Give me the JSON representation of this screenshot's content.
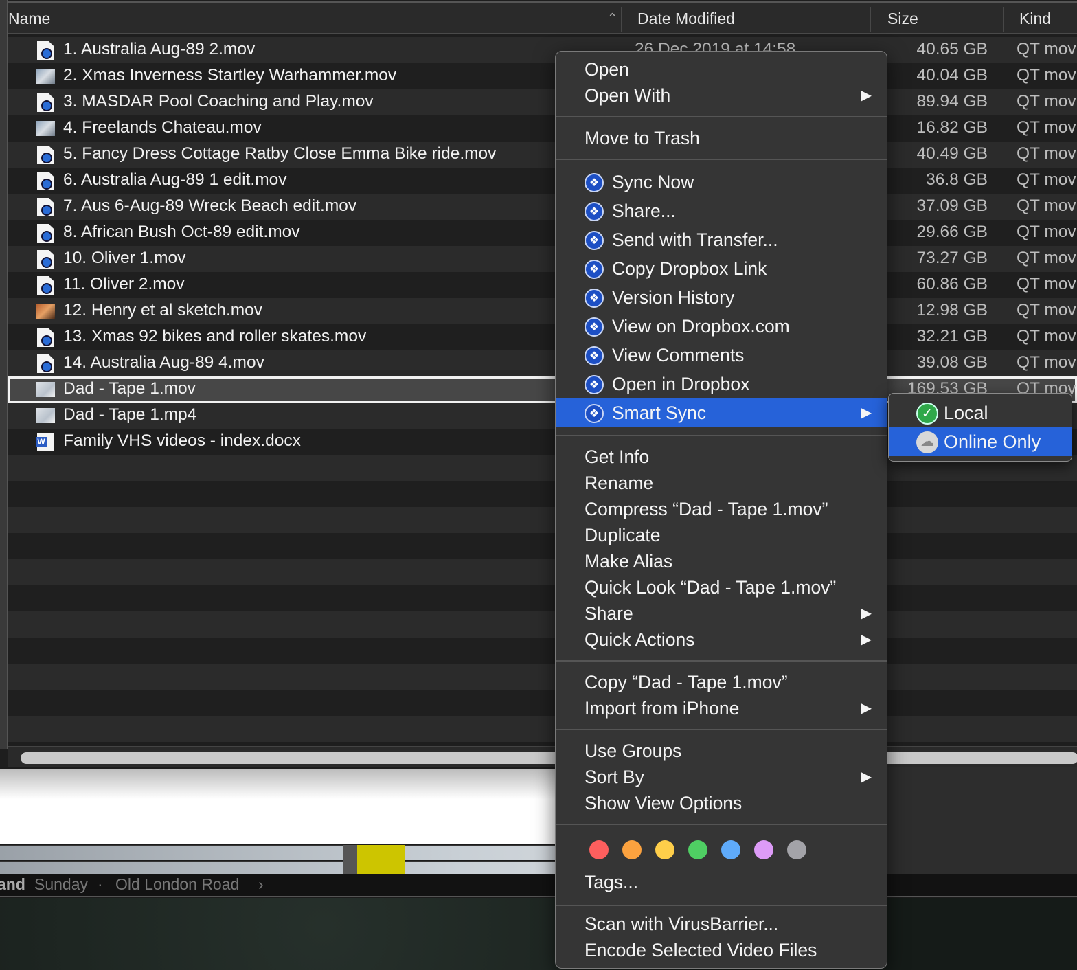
{
  "columns": {
    "name": "Name",
    "date": "Date Modified",
    "size": "Size",
    "kind": "Kind",
    "sort_icon": "chevron-up-icon"
  },
  "files": [
    {
      "name": "1. Australia Aug-89 2.mov",
      "date": "26 Dec 2019 at 14:58",
      "size": "40.65 GB",
      "kind": "QT mov",
      "icon": "doc"
    },
    {
      "name": "2. Xmas Inverness Startley Warhammer.mov",
      "size": "40.04 GB",
      "kind": "QT mov",
      "icon": "thumb"
    },
    {
      "name": "3. MASDAR Pool Coaching and Play.mov",
      "size": "89.94 GB",
      "kind": "QT mov",
      "icon": "doc"
    },
    {
      "name": "4. Freelands Chateau.mov",
      "size": "16.82 GB",
      "kind": "QT mov",
      "icon": "thumb"
    },
    {
      "name": "5. Fancy Dress Cottage Ratby Close Emma Bike ride.mov",
      "size": "40.49 GB",
      "kind": "QT mov",
      "icon": "doc"
    },
    {
      "name": "6. Australia Aug-89 1 edit.mov",
      "size": "36.8 GB",
      "kind": "QT mov",
      "icon": "doc"
    },
    {
      "name": "7. Aus 6-Aug-89 Wreck Beach edit.mov",
      "size": "37.09 GB",
      "kind": "QT mov",
      "icon": "doc"
    },
    {
      "name": "8. African Bush Oct-89 edit.mov",
      "size": "29.66 GB",
      "kind": "QT mov",
      "icon": "doc"
    },
    {
      "name": "10. Oliver 1.mov",
      "size": "73.27 GB",
      "kind": "QT mov",
      "icon": "doc"
    },
    {
      "name": "11. Oliver 2.mov",
      "size": "60.86 GB",
      "kind": "QT mov",
      "icon": "doc"
    },
    {
      "name": "12. Henry et al sketch.mov",
      "size": "12.98 GB",
      "kind": "QT mov",
      "icon": "thumb warm"
    },
    {
      "name": "13. Xmas 92 bikes and roller skates.mov",
      "size": "32.21 GB",
      "kind": "QT mov",
      "icon": "doc"
    },
    {
      "name": "14. Australia Aug-89 4.mov",
      "size": "39.08 GB",
      "kind": "QT mov",
      "icon": "doc"
    },
    {
      "name": "Dad - Tape 1.mov",
      "size": "169.53 GB",
      "kind": "QT mov",
      "icon": "thumb pale",
      "selected": true
    },
    {
      "name": "Dad - Tape 1.mp4",
      "icon": "thumb pale"
    },
    {
      "name": "Family VHS videos - index.docx",
      "icon": "word"
    }
  ],
  "background": {
    "breadcrumb_1": "and",
    "breadcrumb_2": "Sunday",
    "breadcrumb_sep": "·",
    "breadcrumb_3": "Old London Road",
    "breadcrumb_chevron": "›"
  },
  "context_menu": {
    "open": "Open",
    "open_with": "Open With",
    "move_to_trash": "Move to Trash",
    "sync_now": "Sync Now",
    "share_dropbox": "Share...",
    "send_with_transfer": "Send with Transfer...",
    "copy_dropbox_link": "Copy Dropbox Link",
    "version_history": "Version History",
    "view_on_dropbox": "View on Dropbox.com",
    "view_comments": "View Comments",
    "open_in_dropbox": "Open in Dropbox",
    "smart_sync": "Smart Sync",
    "get_info": "Get Info",
    "rename": "Rename",
    "compress": "Compress “Dad - Tape 1.mov”",
    "duplicate": "Duplicate",
    "make_alias": "Make Alias",
    "quick_look": "Quick Look “Dad - Tape 1.mov”",
    "share": "Share",
    "quick_actions": "Quick Actions",
    "copy": "Copy “Dad - Tape 1.mov”",
    "import_from_iphone": "Import from iPhone",
    "use_groups": "Use Groups",
    "sort_by": "Sort By",
    "show_view_options": "Show View Options",
    "tag_colors": [
      "#fe5f5e",
      "#fba23f",
      "#fece4a",
      "#4fcf63",
      "#5fabfb",
      "#dd9bf7",
      "#a3a3a8"
    ],
    "tags": "Tags...",
    "scan_virusbarrier": "Scan with VirusBarrier...",
    "encode_video": "Encode Selected Video Files",
    "submenu_arrow": "▶"
  },
  "smart_sync_submenu": {
    "local": "Local",
    "online_only": "Online Only",
    "highlighted": "Online Only",
    "accent": "#2662d9"
  }
}
